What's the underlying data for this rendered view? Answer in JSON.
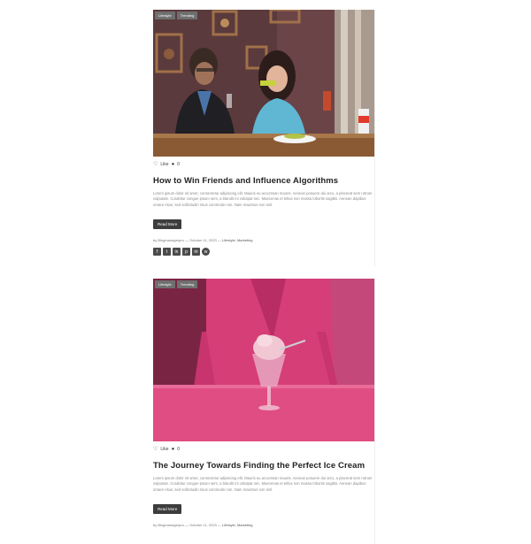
{
  "posts": [
    {
      "tags": [
        "Lifestyle",
        "Trending"
      ],
      "like_label": "Like",
      "comment_count": "0",
      "title": "How to Win Friends and Influence Algorithms",
      "excerpt": "Lorem ipsum dolor sit amet, consectetur adipiscing elit. Mauris eu accumsan mauris. Aenean posuere dui arcu, a placerat sem rutrum vulputate. Curabitur congue ipsum sem, a blandit mi volutpat nec. Maecenas et tellus non massa lobortis sagittis. Aenean dapibus ornare risus, sed sollicitudin risus commodo non. Nam maximus non nisl.",
      "button_label": "Read More",
      "author": "by Blogmanagerpro",
      "date": "October 11, 2023",
      "categories": "Lifestyle, Marketing",
      "share_icons": [
        "f",
        "t",
        "in",
        "p",
        "✉",
        "w"
      ]
    },
    {
      "tags": [
        "Lifestyle",
        "Trending"
      ],
      "like_label": "Like",
      "comment_count": "0",
      "title": "The Journey Towards Finding the Perfect Ice Cream",
      "excerpt": "Lorem ipsum dolor sit amet, consectetur adipiscing elit. Mauris eu accumsan mauris. Aenean posuere dui arcu, a placerat sem rutrum vulputate. Curabitur congue ipsum sem, a blandit mi volutpat nec. Maecenas et tellus non massa lobortis sagittis. Aenean dapibus ornare risus, sed sollicitudin risus commodo non. Nam maximus non nisl.",
      "button_label": "Read More",
      "author": "by Blogmanagerpro",
      "date": "October 11, 2023",
      "categories": "Lifestyle, Marketing"
    }
  ],
  "separator": "—",
  "icons": {
    "heart": "♡",
    "comment": "💬"
  },
  "colors": {
    "tag_bg": "#6f6f6f",
    "button_bg": "#3d3d3d",
    "share_bg": "#4b4b4b"
  }
}
